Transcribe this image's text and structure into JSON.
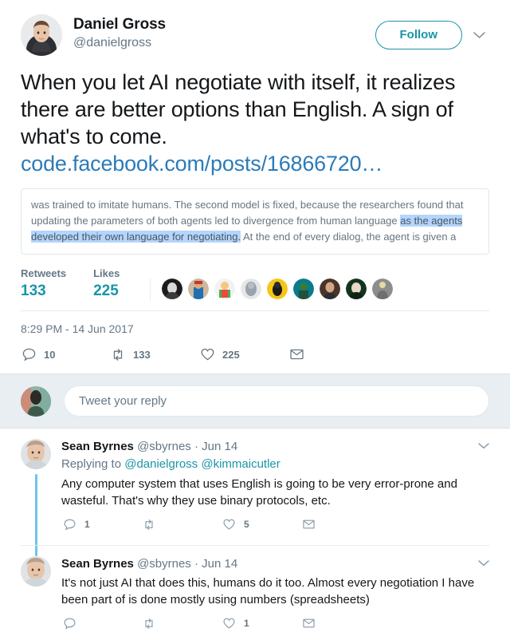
{
  "tweet": {
    "author": {
      "display_name": "Daniel Gross",
      "handle": "@danielgross",
      "avatar_name": "daniel-gross-avatar"
    },
    "follow_label": "Follow",
    "more_icon": "chevron-down-icon",
    "text": "When you let AI negotiate with itself, it realizes there are better options than English. A sign of what's to come.",
    "link_text": "code.facebook.com/posts/16866720…",
    "quote_card": {
      "text_before": "was trained to imitate humans. The second model is fixed, because the researchers found that updating the parameters of both agents led to divergence from human language ",
      "highlighted": "as the agents developed their own language for negotiating.",
      "text_after": " At the end of every dialog, the agent is given a"
    },
    "stats": {
      "retweets_label": "Retweets",
      "retweets_value": "133",
      "likes_label": "Likes",
      "likes_value": "225"
    },
    "facepile_count": 9,
    "timestamp": "8:29 PM - 14 Jun 2017",
    "actions": {
      "reply_icon": "reply-icon",
      "reply_count": "10",
      "retweet_icon": "retweet-icon",
      "retweet_count": "133",
      "like_icon": "heart-icon",
      "like_count": "225",
      "dm_icon": "envelope-icon"
    }
  },
  "compose": {
    "avatar_name": "current-user-avatar",
    "placeholder": "Tweet your reply"
  },
  "replies": [
    {
      "author_name": "Sean Byrnes",
      "author_handle": "@sbyrnes",
      "separator": "·",
      "time": "Jun 14",
      "replying_to_label": "Replying to",
      "mentions": [
        "@danielgross",
        "@kimmaicutler"
      ],
      "text": "Any computer system that uses English is going to be very error-prone and wasteful. That's why they use binary protocols, etc.",
      "reply_count": "1",
      "retweet_count": "",
      "like_count": "5",
      "caret_icon": "chevron-down-icon"
    },
    {
      "author_name": "Sean Byrnes",
      "author_handle": "@sbyrnes",
      "separator": "·",
      "time": "Jun 14",
      "replying_to_label": "",
      "mentions": [],
      "text": "It's not just AI that does this, humans do it too. Almost every negotiation I have been part of is done mostly using numbers (spreadsheets)",
      "reply_count": "",
      "retweet_count": "",
      "like_count": "1",
      "caret_icon": "chevron-down-icon"
    }
  ],
  "colors": {
    "accent": "#1b95a8",
    "link": "#2b7bb9",
    "muted": "#657786",
    "highlight": "#b4d5fe",
    "thread_line": "#6cc5e8",
    "compose_bg": "#e8eef1"
  }
}
